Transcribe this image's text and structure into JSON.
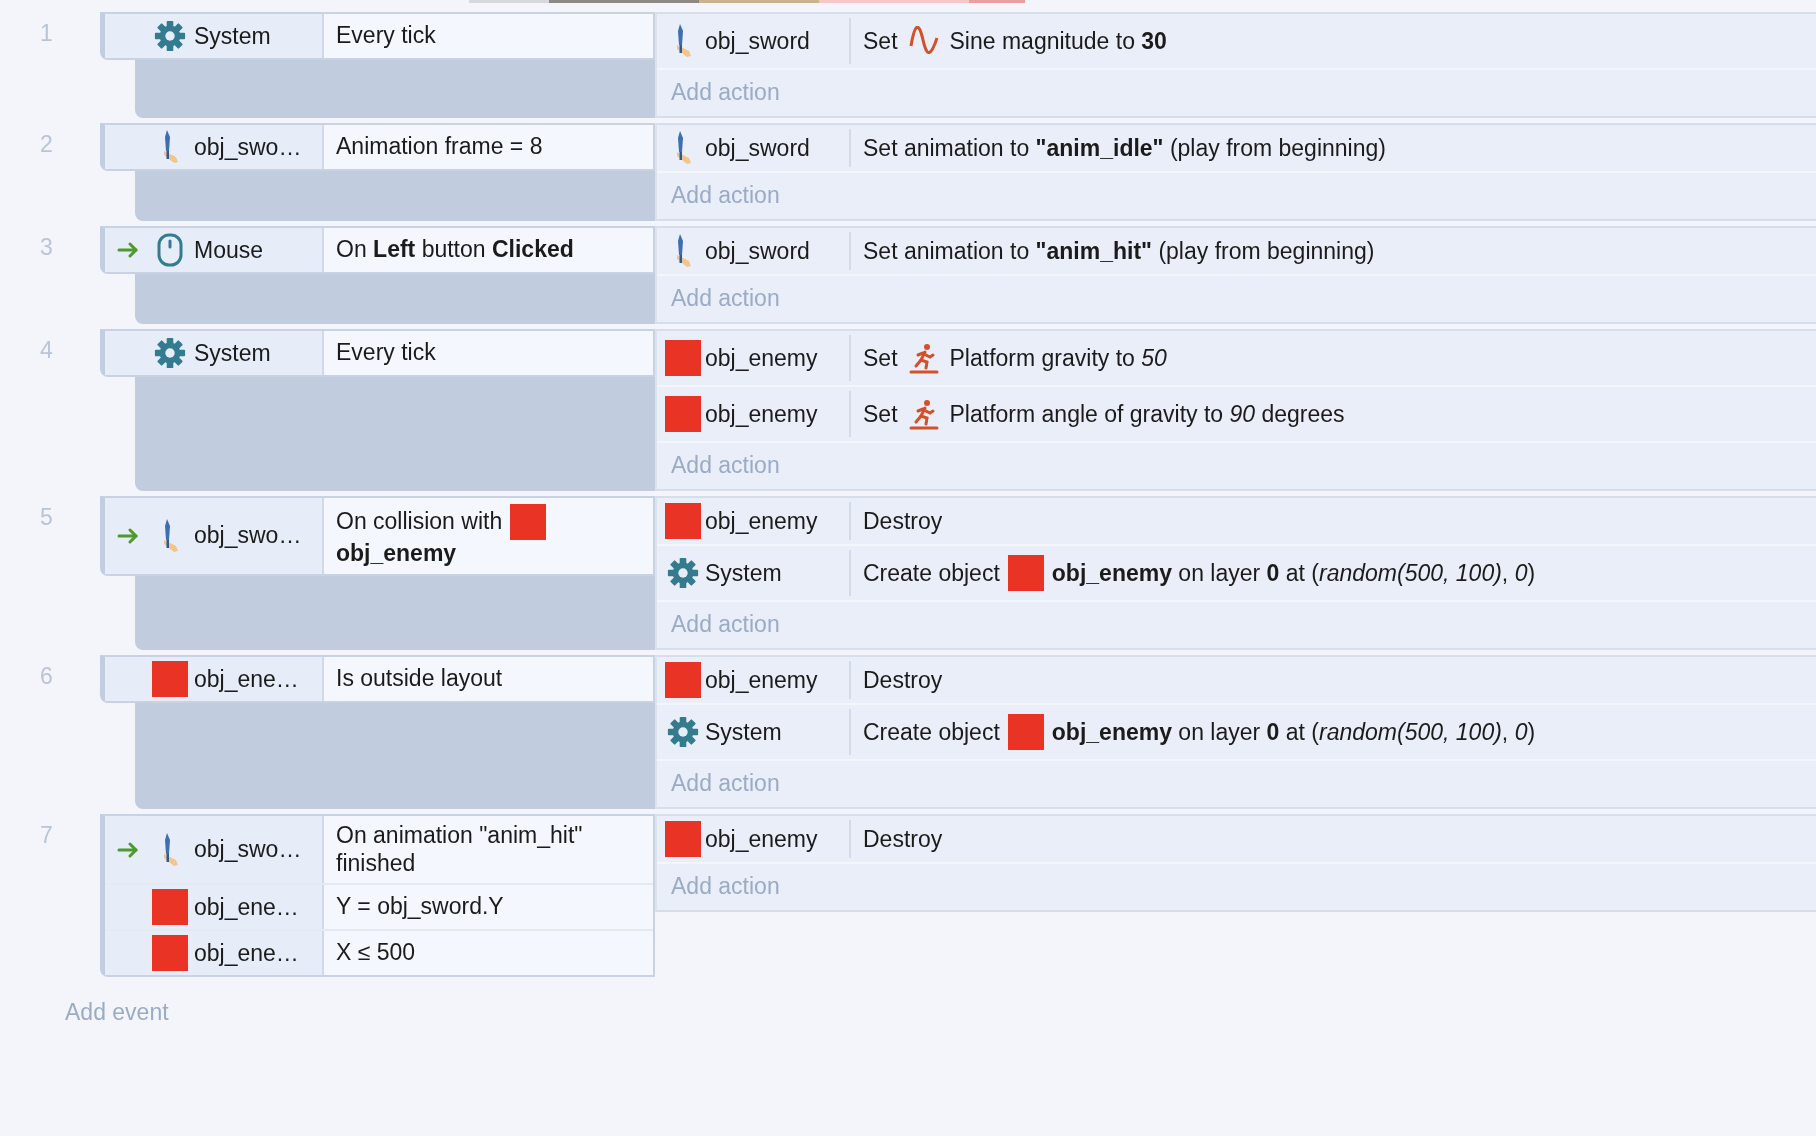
{
  "events": [
    {
      "number": "1",
      "conditions": [
        {
          "trigger": false,
          "object": {
            "name": "System",
            "kind": "system"
          },
          "parts": [
            {
              "kind": "text",
              "text": "Every tick"
            }
          ]
        }
      ],
      "actions": [
        {
          "object": {
            "name": "obj_sword",
            "kind": "sword"
          },
          "parts": [
            {
              "kind": "text",
              "text": "Set"
            },
            {
              "kind": "sine"
            },
            {
              "kind": "text",
              "text": "Sine magnitude to **30**"
            }
          ]
        }
      ],
      "add_action": "Add action"
    },
    {
      "number": "2",
      "conditions": [
        {
          "trigger": false,
          "object": {
            "name": "obj_swo…",
            "kind": "sword"
          },
          "parts": [
            {
              "kind": "text",
              "text": "Animation frame = 8"
            }
          ]
        }
      ],
      "actions": [
        {
          "object": {
            "name": "obj_sword",
            "kind": "sword"
          },
          "parts": [
            {
              "kind": "text",
              "text": "Set animation to **\"anim_idle\"** (play from beginning)"
            }
          ]
        }
      ],
      "add_action": "Add action"
    },
    {
      "number": "3",
      "conditions": [
        {
          "trigger": true,
          "object": {
            "name": "Mouse",
            "kind": "mouse"
          },
          "parts": [
            {
              "kind": "text",
              "text": "On **Left** button **Clicked**"
            }
          ]
        }
      ],
      "actions": [
        {
          "object": {
            "name": "obj_sword",
            "kind": "sword"
          },
          "parts": [
            {
              "kind": "text",
              "text": "Set animation to **\"anim_hit\"** (play from beginning)"
            }
          ]
        }
      ],
      "add_action": "Add action"
    },
    {
      "number": "4",
      "conditions": [
        {
          "trigger": false,
          "object": {
            "name": "System",
            "kind": "system"
          },
          "parts": [
            {
              "kind": "text",
              "text": "Every tick"
            }
          ]
        }
      ],
      "actions": [
        {
          "object": {
            "name": "obj_enemy",
            "kind": "sprite"
          },
          "parts": [
            {
              "kind": "text",
              "text": "Set"
            },
            {
              "kind": "platform"
            },
            {
              "kind": "text",
              "text": "Platform gravity to *50*"
            }
          ]
        },
        {
          "object": {
            "name": "obj_enemy",
            "kind": "sprite"
          },
          "parts": [
            {
              "kind": "text",
              "text": "Set"
            },
            {
              "kind": "platform"
            },
            {
              "kind": "text",
              "text": "Platform angle of gravity to *90* degrees"
            }
          ]
        }
      ],
      "add_action": "Add action"
    },
    {
      "number": "5",
      "conditions": [
        {
          "trigger": true,
          "object": {
            "name": "obj_swo…",
            "kind": "sword"
          },
          "parts": [
            {
              "kind": "text",
              "text": "On collision with"
            },
            {
              "kind": "sprite"
            },
            {
              "kind": "bold",
              "text": "obj_enemy"
            }
          ]
        }
      ],
      "actions": [
        {
          "object": {
            "name": "obj_enemy",
            "kind": "sprite"
          },
          "parts": [
            {
              "kind": "text",
              "text": "Destroy"
            }
          ]
        },
        {
          "object": {
            "name": "System",
            "kind": "system"
          },
          "parts": [
            {
              "kind": "text",
              "text": "Create object"
            },
            {
              "kind": "sprite"
            },
            {
              "kind": "text",
              "text": "**obj_enemy** on layer **0** at (*random(500, 100)*, *0*)"
            }
          ]
        }
      ],
      "add_action": "Add action"
    },
    {
      "number": "6",
      "conditions": [
        {
          "trigger": false,
          "object": {
            "name": "obj_ene…",
            "kind": "sprite"
          },
          "parts": [
            {
              "kind": "text",
              "text": "Is outside layout"
            }
          ]
        }
      ],
      "actions": [
        {
          "object": {
            "name": "obj_enemy",
            "kind": "sprite"
          },
          "parts": [
            {
              "kind": "text",
              "text": "Destroy"
            }
          ]
        },
        {
          "object": {
            "name": "System",
            "kind": "system"
          },
          "parts": [
            {
              "kind": "text",
              "text": "Create object"
            },
            {
              "kind": "sprite"
            },
            {
              "kind": "text",
              "text": "**obj_enemy** on layer **0** at (*random(500, 100)*, *0*)"
            }
          ]
        }
      ],
      "add_action": "Add action"
    },
    {
      "number": "7",
      "conditions": [
        {
          "trigger": true,
          "object": {
            "name": "obj_swo…",
            "kind": "sword"
          },
          "parts": [
            {
              "kind": "text",
              "text": "On animation \"anim_hit\" finished"
            }
          ]
        },
        {
          "trigger": false,
          "object": {
            "name": "obj_ene…",
            "kind": "sprite"
          },
          "parts": [
            {
              "kind": "text",
              "text": "Y = obj_sword.Y"
            }
          ]
        },
        {
          "trigger": false,
          "object": {
            "name": "obj_ene…",
            "kind": "sprite"
          },
          "parts": [
            {
              "kind": "text",
              "text": "X ≤ 500"
            }
          ]
        }
      ],
      "actions": [
        {
          "object": {
            "name": "obj_enemy",
            "kind": "sprite"
          },
          "parts": [
            {
              "kind": "text",
              "text": "Destroy"
            }
          ]
        }
      ],
      "add_action": "Add action"
    }
  ],
  "add_event": "Add event"
}
